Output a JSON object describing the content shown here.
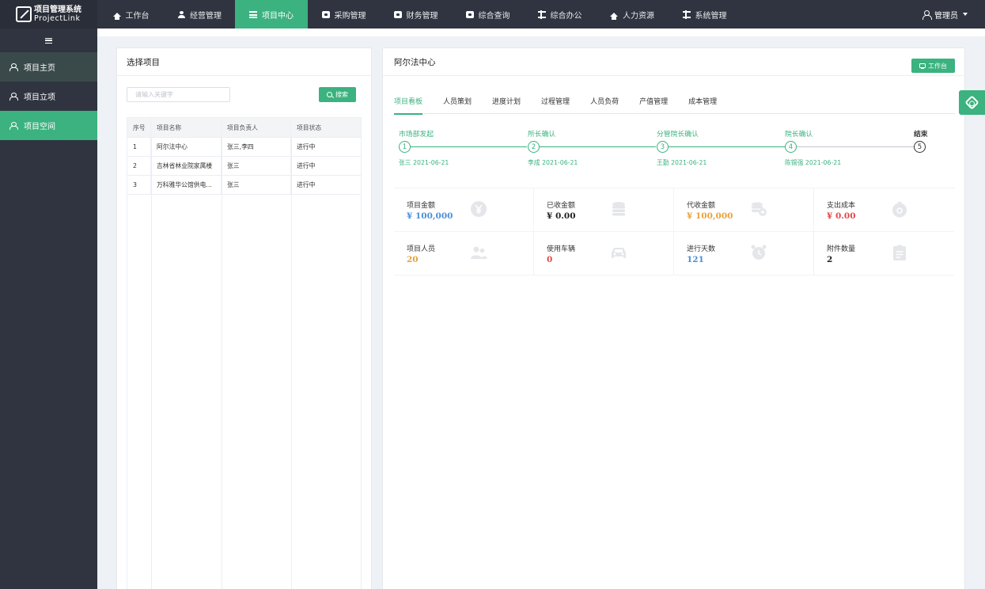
{
  "app": {
    "logo_line1": "项目管理系统",
    "logo_line2": "ProjectLink"
  },
  "topnav": {
    "items": [
      {
        "label": "工作台",
        "icon": "home-icon"
      },
      {
        "label": "经营管理",
        "icon": "user-icon"
      },
      {
        "label": "项目中心",
        "icon": "list-icon",
        "active": true
      },
      {
        "label": "采购管理",
        "icon": "box-icon"
      },
      {
        "label": "财务管理",
        "icon": "box-icon"
      },
      {
        "label": "综合查询",
        "icon": "box-icon"
      },
      {
        "label": "综合办公",
        "icon": "sliders-icon"
      },
      {
        "label": "人力资源",
        "icon": "home-icon"
      },
      {
        "label": "系统管理",
        "icon": "sliders-icon"
      }
    ],
    "user_label": "管理员"
  },
  "sidebar": {
    "items": [
      {
        "label": "项目主页"
      },
      {
        "label": "项目立项"
      },
      {
        "label": "项目空间",
        "active": true
      }
    ]
  },
  "left_panel": {
    "title": "选择项目",
    "search_placeholder": "请输入关键字",
    "search_button": "搜索",
    "table": {
      "headers": [
        "序号",
        "项目名称",
        "项目负责人",
        "项目状态"
      ],
      "rows": [
        [
          "1",
          "阿尔法中心",
          "张三,李四",
          "进行中"
        ],
        [
          "2",
          "吉林省林业院家属楼",
          "张三",
          "进行中"
        ],
        [
          "3",
          "万科雅华公馆供电...",
          "张三",
          "进行中"
        ]
      ]
    }
  },
  "right_panel": {
    "title": "阿尔法中心",
    "workbench_button": "工作台",
    "tabs": [
      "项目看板",
      "人员策划",
      "进度计划",
      "过程管理",
      "人员负荷",
      "产值管理",
      "成本管理"
    ],
    "active_tab": "项目看板",
    "steps": [
      {
        "title": "市场部发起",
        "num": "1",
        "desc": "张三 2021-06-21"
      },
      {
        "title": "所长确认",
        "num": "2",
        "desc": "李成 2021-06-21"
      },
      {
        "title": "分管院长确认",
        "num": "3",
        "desc": "王勤 2021-06-21"
      },
      {
        "title": "院长确认",
        "num": "4",
        "desc": "陈锡强 2021-06-21"
      },
      {
        "title": "结束",
        "num": "5",
        "desc": ""
      }
    ],
    "stats": [
      {
        "label": "项目金额",
        "value": "¥ 100,000",
        "color": "#4a8fd8",
        "icon": "yen-icon"
      },
      {
        "label": "已收金额",
        "value": "¥ 0.00",
        "color": "#222222",
        "icon": "coins-icon"
      },
      {
        "label": "代收金额",
        "value": "¥ 100,000",
        "color": "#e6a23c",
        "icon": "coin-add-icon"
      },
      {
        "label": "支出成本",
        "value": "¥ 0.00",
        "color": "#e04848",
        "icon": "money-bag-icon"
      },
      {
        "label": "项目人员",
        "value": "20",
        "color": "#e6a23c",
        "icon": "people-icon"
      },
      {
        "label": "使用车辆",
        "value": "0",
        "color": "#e04848",
        "icon": "car-icon"
      },
      {
        "label": "进行天数",
        "value": "121",
        "color": "#4a8fd8",
        "icon": "alarm-clock-icon"
      },
      {
        "label": "附件数量",
        "value": "2",
        "color": "#222222",
        "icon": "clipboard-icon"
      }
    ]
  },
  "colors": {
    "accent": "#3bb27f",
    "topbar": "#2f3440"
  }
}
